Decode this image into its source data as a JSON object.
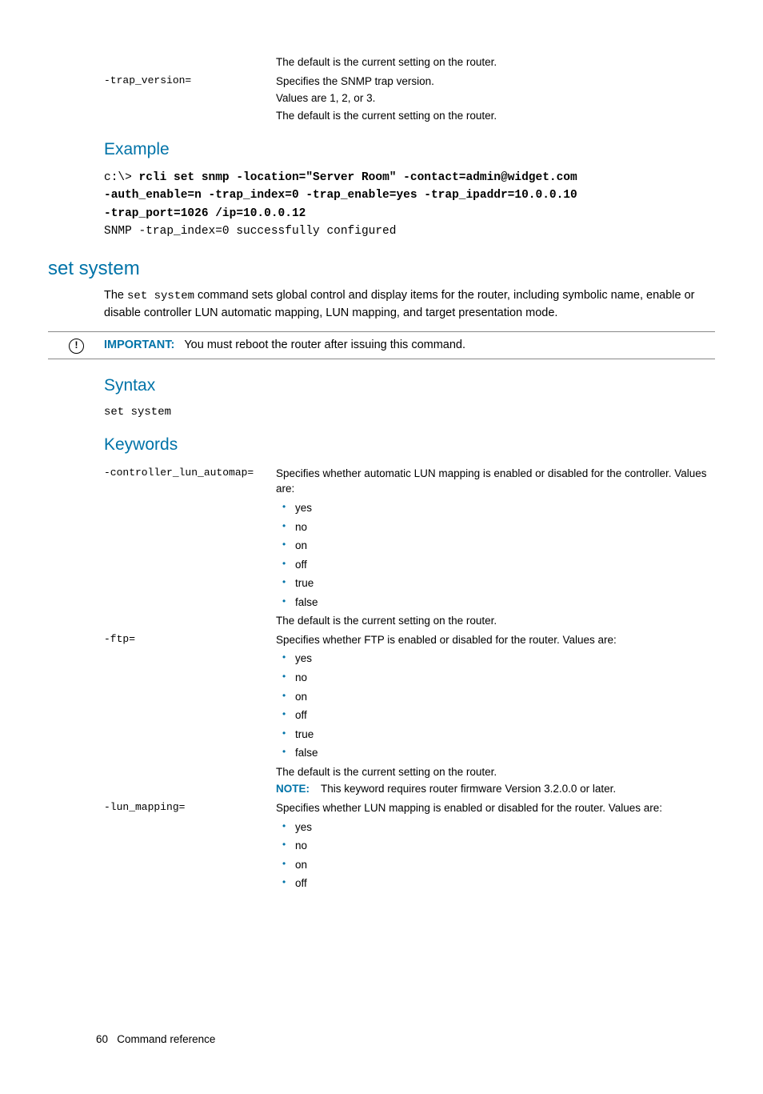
{
  "top_table": {
    "row0_right_line3": "The default is the current setting on the router.",
    "row1_left": "-trap_version=",
    "row1_right_line1": "Specifies the SNMP trap version.",
    "row1_right_line2": "Values are 1, 2, or 3.",
    "row1_right_line3": "The default is the current setting on the router."
  },
  "example": {
    "heading": "Example",
    "prompt": "c:\\> ",
    "cmd_line1": "rcli set snmp -location=\"Server Room\" -contact=admin@widget.com",
    "cmd_line2": "-auth_enable=n -trap_index=0 -trap_enable=yes -trap_ipaddr=10.0.0.10",
    "cmd_line3": "-trap_port=1026 /ip=10.0.0.12",
    "output": "SNMP -trap_index=0 successfully configured"
  },
  "set_system": {
    "heading": "set system",
    "intro_pre": "The ",
    "intro_code": "set system",
    "intro_post": " command sets global control and display items for the router, including symbolic name, enable or disable controller LUN automatic mapping, LUN mapping, and target presentation mode.",
    "important_label": "IMPORTANT:",
    "important_text": "You must reboot the router after issuing this command.",
    "syntax_heading": "Syntax",
    "syntax_code": "set system",
    "keywords_heading": "Keywords",
    "keywords": {
      "controller_lun_automap": {
        "name": "-controller_lun_automap=",
        "desc": "Specifies whether automatic LUN mapping is enabled or disabled for the controller. Values are:",
        "values": [
          "yes",
          "no",
          "on",
          "off",
          "true",
          "false"
        ],
        "default_note": "The default is the current setting on the router."
      },
      "ftp": {
        "name": "-ftp=",
        "desc": "Specifies whether FTP is enabled or disabled for the router. Values are:",
        "values": [
          "yes",
          "no",
          "on",
          "off",
          "true",
          "false"
        ],
        "default_note": "The default is the current setting on the router.",
        "note_label": "NOTE:",
        "note_text": "This keyword requires router firmware Version 3.2.0.0 or later."
      },
      "lun_mapping": {
        "name": "-lun_mapping=",
        "desc": "Specifies whether LUN mapping is enabled or disabled for the router. Values are:",
        "values": [
          "yes",
          "no",
          "on",
          "off"
        ]
      }
    }
  },
  "footer": {
    "page_number": "60",
    "section": "Command reference"
  }
}
